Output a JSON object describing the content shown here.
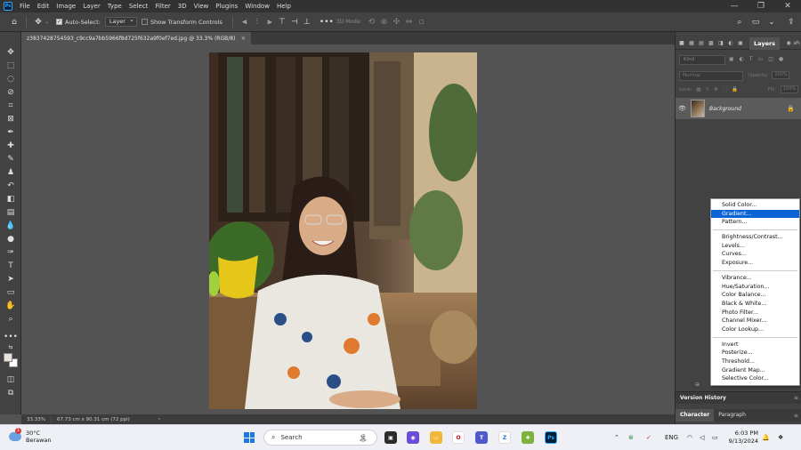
{
  "app": {
    "menus": [
      "File",
      "Edit",
      "Image",
      "Layer",
      "Type",
      "Select",
      "Filter",
      "3D",
      "View",
      "Plugins",
      "Window",
      "Help"
    ],
    "window_controls": [
      "—",
      "❐",
      "✕"
    ]
  },
  "options_bar": {
    "auto_select_label": "Auto-Select:",
    "auto_select_value": "Layer",
    "show_transform_label": "Show Transform Controls",
    "mode_3d_label": "3D Mode:"
  },
  "document": {
    "tab_title": "z3837428754593_c9cc9a7bb5966f8d725f632a9f0ef7ed.jpg @ 33.3% (RGB/8)",
    "close": "×"
  },
  "status": {
    "zoom": "33.33%",
    "dimensions": "67.73 cm x 90.31 cm (72 ppi)",
    "chevron": "›"
  },
  "layers_panel": {
    "tab_title": "Layers",
    "search_placeholder": "Kind",
    "blend_mode": "Normal",
    "opacity_label": "Opacity:",
    "opacity_value": "100%",
    "lock_label": "Lock:",
    "fill_label": "Fill:",
    "fill_value": "100%",
    "layer_name": "Background"
  },
  "version_history": {
    "title": "Version History"
  },
  "character_tabs": {
    "character": "Character",
    "paragraph": "Paragraph"
  },
  "adjustment_menu": {
    "group1": [
      "Solid Color...",
      "Gradient...",
      "Pattern..."
    ],
    "group2": [
      "Brightness/Contrast...",
      "Levels...",
      "Curves...",
      "Exposure..."
    ],
    "group3": [
      "Vibrance...",
      "Hue/Saturation...",
      "Color Balance...",
      "Black & White...",
      "Photo Filter...",
      "Channel Mixer...",
      "Color Lookup..."
    ],
    "group4": [
      "Invert",
      "Posterize...",
      "Threshold...",
      "Gradient Map...",
      "Selective Color..."
    ],
    "highlighted": "Gradient..."
  },
  "taskbar": {
    "weather_temp": "30°C",
    "weather_desc": "Berawan",
    "weather_badge": "1",
    "search_label": "Search",
    "language": "ENG",
    "time": "6:03 PM",
    "date": "9/13/2024"
  },
  "colors": {
    "accent": "#0a64d4",
    "ps_blue": "#31a8ff",
    "foreground_swatch": "#e9e4dc",
    "background_swatch": "#ffffff"
  }
}
